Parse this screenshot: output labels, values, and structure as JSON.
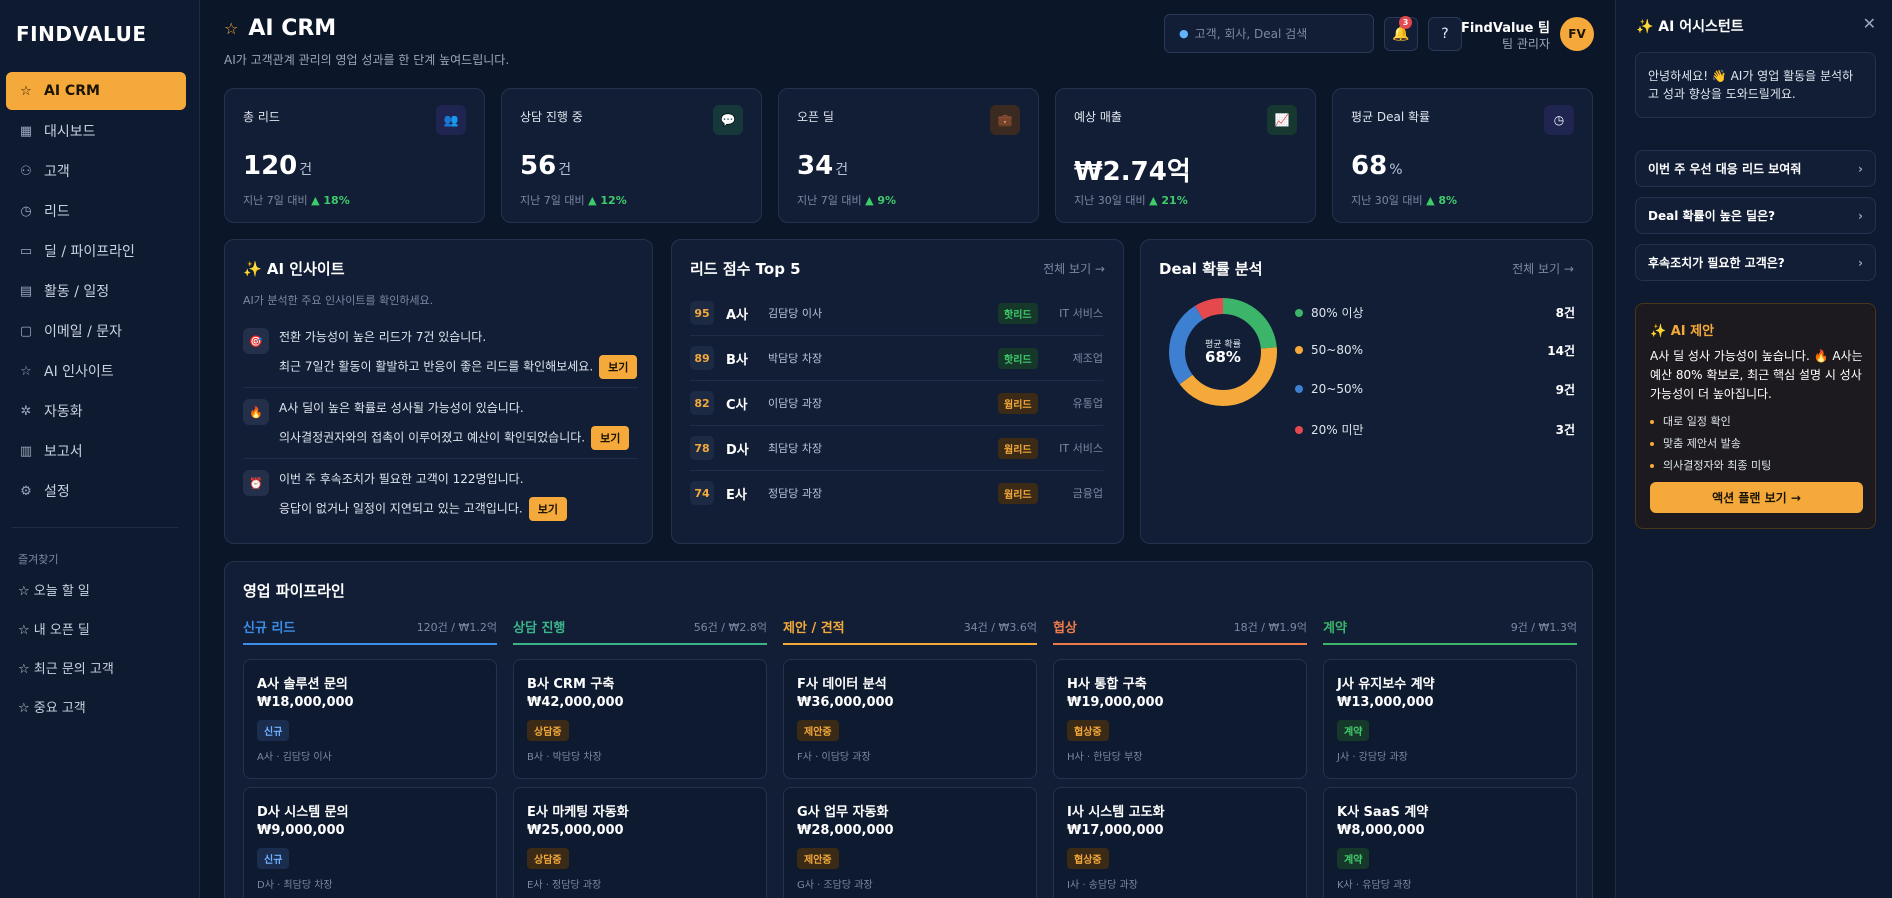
{
  "app": {
    "logo": "FINDVALUE"
  },
  "sidebar": {
    "items": [
      {
        "label": "AI CRM",
        "icon": "star-icon"
      },
      {
        "label": "대시보드",
        "icon": "grid-icon"
      },
      {
        "label": "고객",
        "icon": "users-icon"
      },
      {
        "label": "리드",
        "icon": "clock-icon"
      },
      {
        "label": "딜 / 파이프라인",
        "icon": "folder-icon"
      },
      {
        "label": "활동 / 일정",
        "icon": "document-icon"
      },
      {
        "label": "이메일 / 문자",
        "icon": "chat-icon"
      },
      {
        "label": "AI 인사이트",
        "icon": "star-outline-icon"
      },
      {
        "label": "자동화",
        "icon": "gear-icon"
      },
      {
        "label": "보고서",
        "icon": "bar-chart-icon"
      },
      {
        "label": "설정",
        "icon": "settings-icon"
      }
    ],
    "favorites_title": "즐겨찾기",
    "favorites": [
      "☆ 오늘 할 일",
      "☆ 내 오픈 딜",
      "☆ 최근 문의 고객",
      "☆ 중요 고객"
    ]
  },
  "header": {
    "title": "AI CRM",
    "subtitle": "AI가 고객관계 관리의 영업 성과를 한 단계 높여드립니다.",
    "search_placeholder": "고객, 회사, Deal 검색",
    "notification_count": "3",
    "help": "?",
    "user_name": "FindValue 팀",
    "user_role": "팀 관리자",
    "avatar": "FV"
  },
  "stats": [
    {
      "label": "총 리드",
      "value": "120",
      "unit": "건",
      "period": "지난 7일 대비",
      "change": "▲ 18%",
      "icon": "people-icon",
      "icon_color": "#8b6cff",
      "icon_bg": "#1f2550"
    },
    {
      "label": "상담 진행 중",
      "value": "56",
      "unit": "건",
      "period": "지난 7일 대비",
      "change": "▲ 12%",
      "icon": "speech-bubble-icon",
      "icon_color": "#ffffff",
      "icon_bg": "#16383a"
    },
    {
      "label": "오픈 딜",
      "value": "34",
      "unit": "건",
      "period": "지난 7일 대비",
      "change": "▲ 9%",
      "icon": "briefcase-icon",
      "icon_color": "#d46a3a",
      "icon_bg": "#3a2a20"
    },
    {
      "label": "예상 매출",
      "value": "₩2.74억",
      "unit": "",
      "period": "지난 30일 대비",
      "change": "▲ 21%",
      "icon": "trend-chart-icon",
      "icon_color": "#3ecb6a",
      "icon_bg": "#163830"
    },
    {
      "label": "평균 Deal 확률",
      "value": "68",
      "unit": "%",
      "period": "지난 30일 대비",
      "change": "▲ 8%",
      "icon": "clock-icon",
      "icon_color": "#ffffff",
      "icon_bg": "#1f2550"
    }
  ],
  "insights": {
    "title": "✨ AI 인사이트",
    "subtitle": "AI가 분석한 주요 인사이트를 확인하세요.",
    "button": "보기",
    "items": [
      {
        "icon": "target-icon",
        "line1": "전환 가능성이 높은 리드가 7건 있습니다.",
        "line2": "최근 7일간 활동이 활발하고 반응이 좋은 리드를 확인해보세요."
      },
      {
        "icon": "fire-icon",
        "line1": "A사 딜이 높은 확률로 성사될 가능성이 있습니다.",
        "line2": "의사결정권자와의 접촉이 이루어졌고 예산이 확인되었습니다."
      },
      {
        "icon": "alarm-icon",
        "line1": "이번 주 후속조치가 필요한 고객이 122명입니다.",
        "line2": "응답이 없거나 일정이 지연되고 있는 고객입니다."
      }
    ]
  },
  "leads": {
    "title": "리드 점수 Top 5",
    "view_all": "전체 보기 →",
    "rows": [
      {
        "score": "95",
        "company": "A사",
        "person": "김담당 이사",
        "tag": "핫리드",
        "tag_type": "hot",
        "industry": "IT 서비스"
      },
      {
        "score": "89",
        "company": "B사",
        "person": "박담당 차장",
        "tag": "핫리드",
        "tag_type": "hot",
        "industry": "제조업"
      },
      {
        "score": "82",
        "company": "C사",
        "person": "이담당 과장",
        "tag": "웜리드",
        "tag_type": "warm",
        "industry": "유통업"
      },
      {
        "score": "78",
        "company": "D사",
        "person": "최담당 차장",
        "tag": "웜리드",
        "tag_type": "warm",
        "industry": "IT 서비스"
      },
      {
        "score": "74",
        "company": "E사",
        "person": "정담당 과장",
        "tag": "웜리드",
        "tag_type": "warm",
        "industry": "금융업"
      }
    ]
  },
  "deal": {
    "title": "Deal 확률 분석",
    "view_all": "전체 보기 →",
    "center_label": "평균 확률",
    "center_value": "68%",
    "segments": [
      {
        "label": "80% 이상",
        "count": "8건",
        "value": 8,
        "color": "#3cb46a"
      },
      {
        "label": "50~80%",
        "count": "14건",
        "value": 14,
        "color": "#f4a93a"
      },
      {
        "label": "20~50%",
        "count": "9건",
        "value": 9,
        "color": "#3d7fd0"
      },
      {
        "label": "20% 미만",
        "count": "3건",
        "value": 3,
        "color": "#e5484d"
      }
    ]
  },
  "pipeline": {
    "title": "영업 파이프라인",
    "columns": [
      {
        "name": "신규 리드",
        "meta": "120건 / ₩1.2억",
        "color": "#3d8ee8",
        "tag_bg": "#1a2d4e",
        "tag_fg": "#6fb2ff",
        "cards": [
          {
            "title": "A사 솔루션 문의",
            "amount": "₩18,000,000",
            "tag": "신규",
            "person": "A사 · 김담당 이사"
          },
          {
            "title": "D사 시스템 문의",
            "amount": "₩9,000,000",
            "tag": "신규",
            "person": "D사 · 최담당 차장"
          }
        ]
      },
      {
        "name": "상담 진행",
        "meta": "56건 / ₩2.8억",
        "color": "#3cb48a",
        "tag_bg": "#3a2a16",
        "tag_fg": "#f4a93a",
        "cards": [
          {
            "title": "B사 CRM 구축",
            "amount": "₩42,000,000",
            "tag": "상담중",
            "person": "B사 · 박담당 차장"
          },
          {
            "title": "E사 마케팅 자동화",
            "amount": "₩25,000,000",
            "tag": "상담중",
            "person": "E사 · 정담당 과장"
          }
        ]
      },
      {
        "name": "제안 / 견적",
        "meta": "34건 / ₩3.6억",
        "color": "#f4a93a",
        "tag_bg": "#3a2a16",
        "tag_fg": "#f4a93a",
        "cards": [
          {
            "title": "F사 데이터 분석",
            "amount": "₩36,000,000",
            "tag": "제안중",
            "person": "F사 · 이담당 과장"
          },
          {
            "title": "G사 업무 자동화",
            "amount": "₩28,000,000",
            "tag": "제안중",
            "person": "G사 · 조담당 과장"
          }
        ]
      },
      {
        "name": "협상",
        "meta": "18건 / ₩1.9억",
        "color": "#ee7a4a",
        "tag_bg": "#3a2a16",
        "tag_fg": "#f4a93a",
        "cards": [
          {
            "title": "H사 통합 구축",
            "amount": "₩19,000,000",
            "tag": "협상중",
            "person": "H사 · 한담당 부장"
          },
          {
            "title": "I사 시스템 고도화",
            "amount": "₩17,000,000",
            "tag": "협상중",
            "person": "I사 · 송담당 과장"
          }
        ]
      },
      {
        "name": "계약",
        "meta": "9건 / ₩1.3억",
        "color": "#3cb46a",
        "tag_bg": "#16382a",
        "tag_fg": "#3ecb6a",
        "cards": [
          {
            "title": "J사 유지보수 계약",
            "amount": "₩13,000,000",
            "tag": "계약",
            "person": "J사 · 강담당 과장"
          },
          {
            "title": "K사 SaaS 계약",
            "amount": "₩8,000,000",
            "tag": "계약",
            "person": "K사 · 유담당 과장"
          }
        ]
      }
    ]
  },
  "assistant": {
    "title": "✨ AI 어시스턴트",
    "greeting": "안녕하세요! 👋 AI가 영업 활동을 분석하고 성과 향상을 도와드릴게요.",
    "questions": [
      "이번 주 우선 대응 리드 보여줘",
      "Deal 확률이 높은 딜은?",
      "후속조치가 필요한 고객은?"
    ],
    "suggestion_title": "✨ AI 제안",
    "suggestion_body": "A사 딜 성사 가능성이 높습니다. 🔥 A사는 예산 80% 확보로, 최근 핵심 설명 시 성사 가능성이 더 높아집니다.",
    "suggestion_items": [
      "대로 일정 확인",
      "맞춤 제안서 발송",
      "의사결정자와 최종 미팅"
    ],
    "action_button": "액션 플랜 보기 →"
  }
}
